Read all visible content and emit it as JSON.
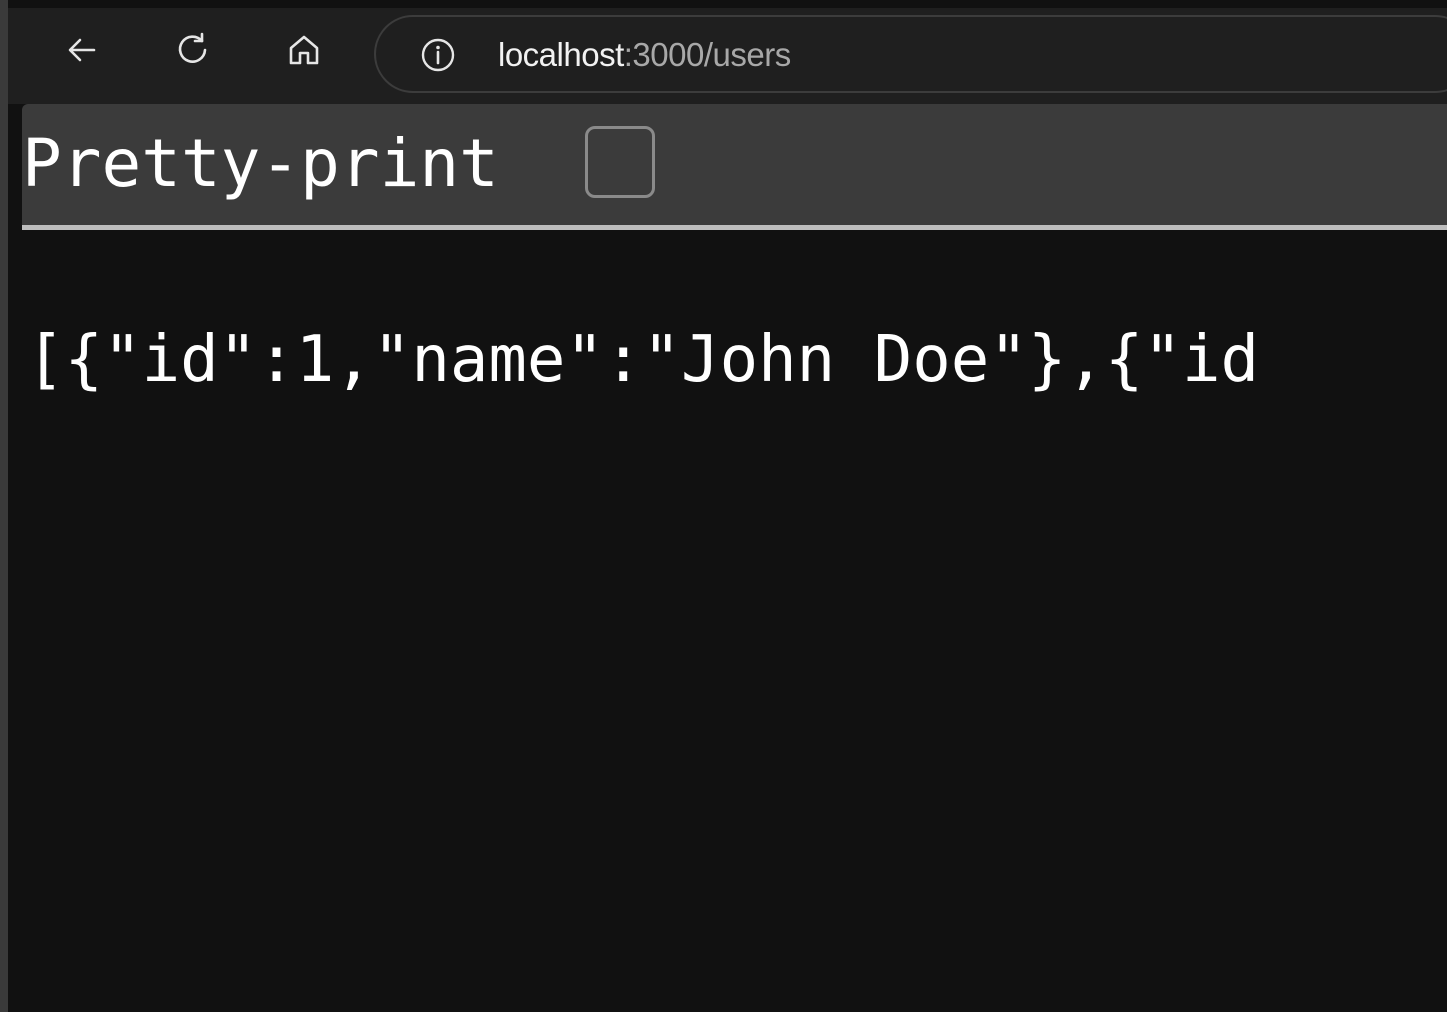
{
  "toolbar": {
    "back_icon": "back-arrow-icon",
    "reload_icon": "reload-icon",
    "home_icon": "home-icon"
  },
  "address_bar": {
    "info_icon": "info-icon",
    "host": "localhost",
    "path": ":3000/users"
  },
  "viewer": {
    "pretty_print_label": "Pretty-print",
    "pretty_print_checked": false,
    "json_text": "[{\"id\":1,\"name\":\"John Doe\"},{\"id"
  },
  "colors": {
    "page_background": "#111111",
    "toolbar_background": "#1f1f1f",
    "pretty_print_bar": "#3b3b3b",
    "text": "#ffffff"
  }
}
